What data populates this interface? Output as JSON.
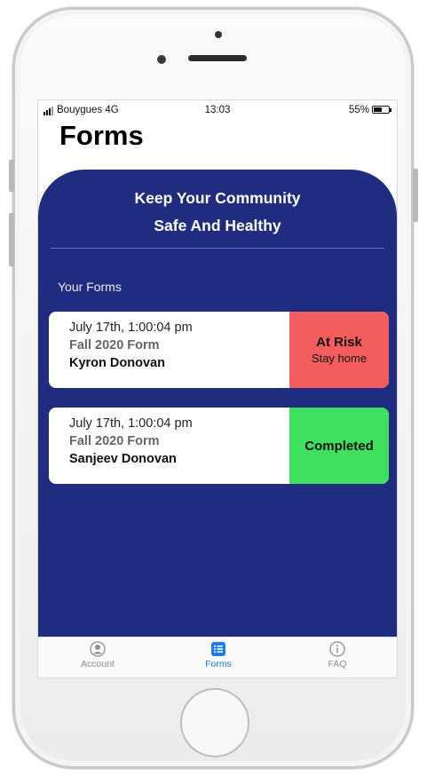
{
  "status_bar": {
    "carrier": "Bouygues 4G",
    "time": "13:03",
    "battery": "55%"
  },
  "page": {
    "title": "Forms"
  },
  "hero": {
    "line1": "Keep Your Community",
    "line2": "Safe And Healthy"
  },
  "section": {
    "label": "Your Forms"
  },
  "forms": [
    {
      "date": "July 17th, 1:00:04 pm",
      "form_name": "Fall 2020 Form",
      "person": "Kyron Donovan",
      "status": "At Risk",
      "status_note": "Stay home",
      "status_color": "#f45d5d"
    },
    {
      "date": "July 17th, 1:00:04 pm",
      "form_name": "Fall 2020 Form",
      "person": "Sanjeev Donovan",
      "status": "Completed",
      "status_note": "",
      "status_color": "#3fe05f"
    }
  ],
  "tabs": [
    {
      "label": "Account",
      "icon": "account-icon",
      "active": false
    },
    {
      "label": "Forms",
      "icon": "forms-list-icon",
      "active": true
    },
    {
      "label": "FAQ",
      "icon": "info-icon",
      "active": false
    }
  ],
  "colors": {
    "panel": "#1f2c80",
    "accent": "#1d7cf2"
  }
}
